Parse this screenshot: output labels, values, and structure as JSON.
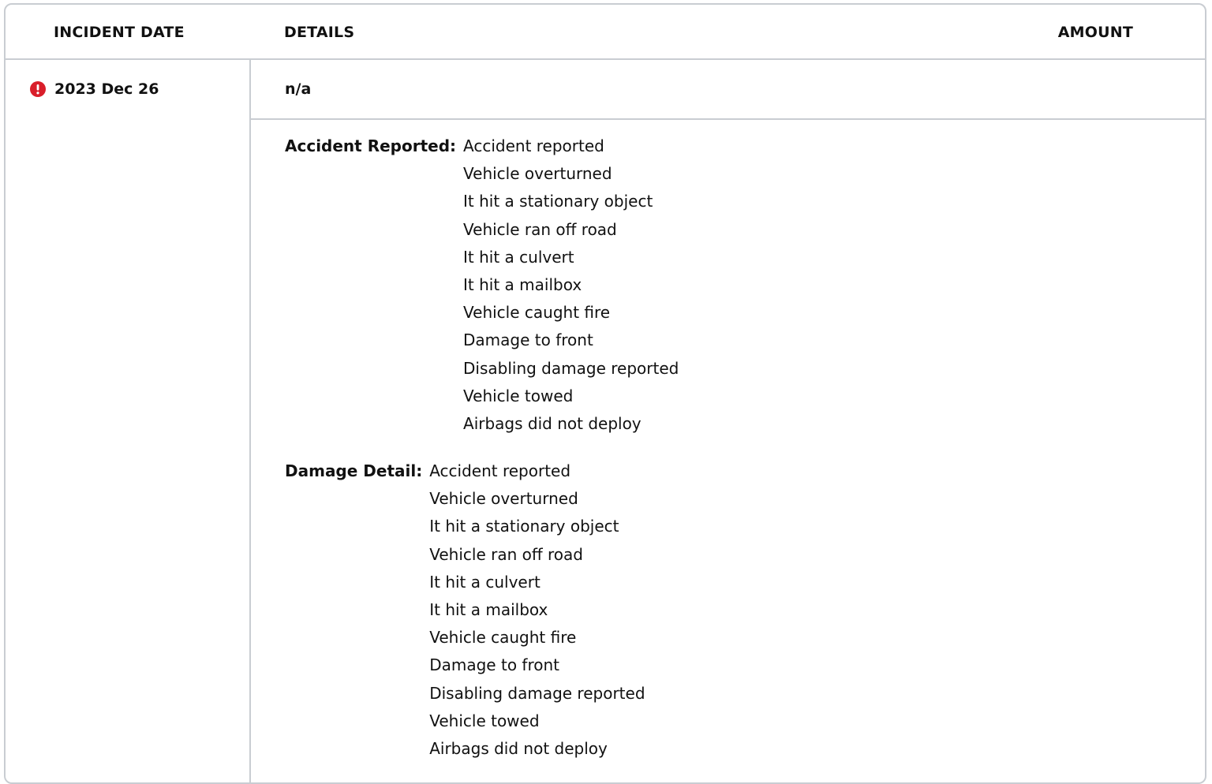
{
  "table": {
    "headers": {
      "incident_date": "INCIDENT DATE",
      "details": "DETAILS",
      "amount": "AMOUNT"
    },
    "record": {
      "date": "2023 Dec 26",
      "status_icon": "alert-circle-icon",
      "status_color": "#d91e2a",
      "summary": "n/a",
      "accident_reported": {
        "label": "Accident Reported:",
        "items": [
          "Accident reported",
          "Vehicle overturned",
          "It hit a stationary object",
          "Vehicle ran off road",
          "It hit a culvert",
          "It hit a mailbox",
          "Vehicle caught fire",
          "Damage to front",
          "Disabling damage reported",
          "Vehicle towed",
          "Airbags did not deploy"
        ]
      },
      "damage_detail": {
        "label": "Damage Detail:",
        "items": [
          "Accident reported",
          "Vehicle overturned",
          "It hit a stationary object",
          "Vehicle ran off road",
          "It hit a culvert",
          "It hit a mailbox",
          "Vehicle caught fire",
          "Damage to front",
          "Disabling damage reported",
          "Vehicle towed",
          "Airbags did not deploy"
        ]
      }
    }
  }
}
